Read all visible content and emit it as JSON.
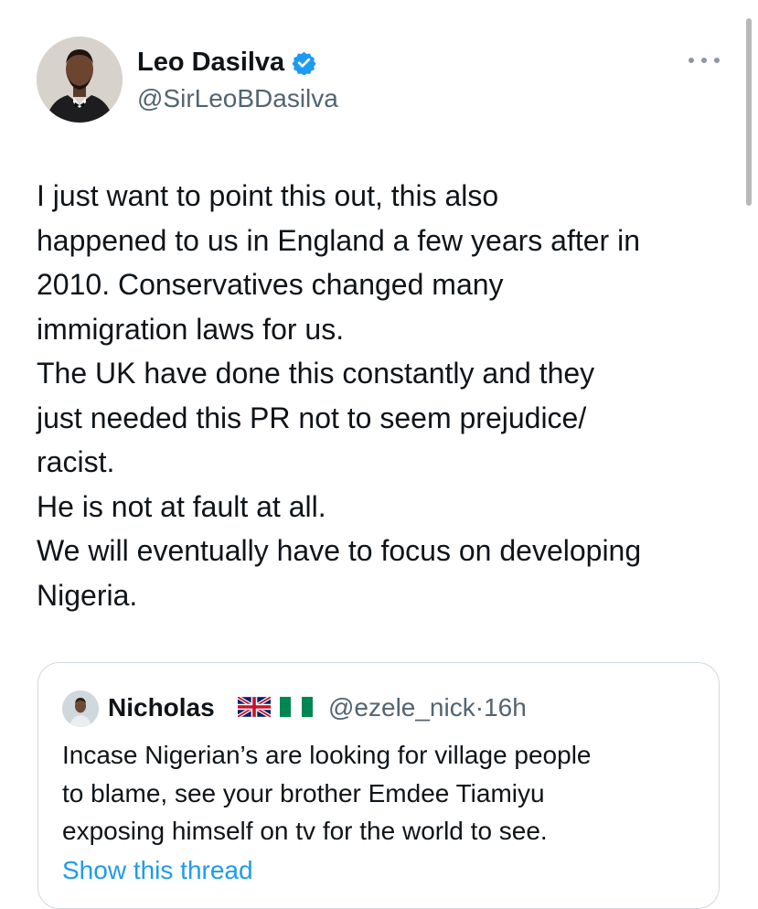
{
  "author": {
    "name": "Leo Dasilva",
    "handle": "@SirLeoBDasilva"
  },
  "tweet": {
    "lines": [
      "I just want to point this out, this also",
      "happened to us in England a few years after in",
      "2010. Conservatives changed many",
      "immigration laws for us.",
      "The UK have done this constantly and they",
      "just needed this PR not to seem prejudice/",
      "racist.",
      "He is not at fault at all.",
      "We will eventually have to focus on developing",
      "Nigeria."
    ]
  },
  "quote": {
    "name": "Nicholas",
    "handle": "@ezele_nick",
    "separator": "·",
    "time": "16h",
    "lines": [
      "Incase Nigerian’s are looking for village people",
      "to blame, see your brother Emdee Tiamiyu",
      "exposing himself on tv for the world to see."
    ],
    "show_thread": "Show this thread"
  },
  "icons": {
    "verified": "verified-badge-icon",
    "more": "more-options-icon",
    "flags": [
      "uk-flag-icon",
      "nigeria-flag-icon"
    ]
  },
  "colors": {
    "text": "#0f1419",
    "secondary": "#536471",
    "link": "#1d9bf0",
    "border": "#cfd9de"
  }
}
